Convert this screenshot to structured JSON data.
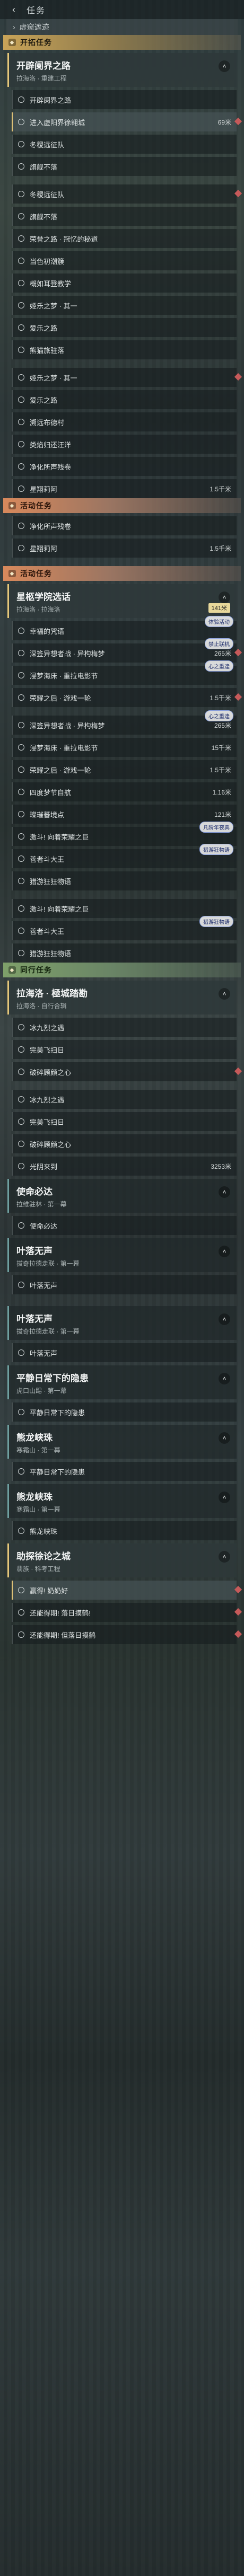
{
  "header": {
    "title": "任务",
    "hidden_toggle": "虚窥遮迹"
  },
  "categories": {
    "trailblaze": "开拓任务",
    "event": "活动任务",
    "companion": "同行任务"
  },
  "blocks": [
    {
      "type": "cat",
      "cls": "trailblaze",
      "key": "trailblaze"
    },
    {
      "type": "quest",
      "active": true,
      "title": "开辟阑界之路",
      "sub": "拉海洛 · 重建工程",
      "chev": "˄"
    },
    {
      "type": "step",
      "text": "开辟阑界之路"
    },
    {
      "type": "step",
      "hl": true,
      "text": "进入虚阳界徐翱城",
      "dist": "69米",
      "mark": true
    },
    {
      "type": "step",
      "text": "冬稷远征队"
    },
    {
      "type": "step",
      "text": "旗舰不落"
    },
    {
      "type": "gap"
    },
    {
      "type": "step",
      "text": "冬稷远征队",
      "mark": true
    },
    {
      "type": "step",
      "text": "旗舰不落"
    },
    {
      "type": "step",
      "text": "荣誉之路 · 冠忆的秘道"
    },
    {
      "type": "step",
      "text": "当色初潮簇"
    },
    {
      "type": "step",
      "text": "概如耳登教学"
    },
    {
      "type": "step",
      "text": "姬乐之梦 · 其一"
    },
    {
      "type": "step",
      "text": "爱乐之路"
    },
    {
      "type": "step",
      "text": "熊猫旅驻落"
    },
    {
      "type": "gap"
    },
    {
      "type": "step",
      "text": "姬乐之梦 · 其一",
      "mark": true
    },
    {
      "type": "step",
      "text": "爱乐之路"
    },
    {
      "type": "step",
      "text": "溯远布德村"
    },
    {
      "type": "step",
      "text": "类焰归还汪洋"
    },
    {
      "type": "step",
      "text": "净化所声残卷"
    },
    {
      "type": "step",
      "text": "星翔莉阿",
      "dist": "1.5千米"
    },
    {
      "type": "cat",
      "cls": "event",
      "key": "event"
    },
    {
      "type": "step",
      "text": "净化所声残卷"
    },
    {
      "type": "step",
      "text": "星翔莉阿",
      "dist": "1.5千米"
    },
    {
      "type": "section-gap"
    },
    {
      "type": "cat",
      "cls": "event",
      "key": "event"
    },
    {
      "type": "quest",
      "active": true,
      "title": "星柩学院选话",
      "sub": "拉海洛 · 拉海洛",
      "chev": "˄",
      "pill": "141米"
    },
    {
      "type": "step",
      "text": "幸福的咒语",
      "tag": "体验活动"
    },
    {
      "type": "step",
      "text": "深签异想者战 · 异构梅梦",
      "dist": "265米",
      "tag": "禁止联机",
      "mark": true
    },
    {
      "type": "step",
      "text": "浸梦海床 · 重拉电影节",
      "tag": "心之重逢"
    },
    {
      "type": "step",
      "text": "荣耀之后 · 游戏一轮",
      "dist": "1.5千米",
      "mark": true
    },
    {
      "type": "gap"
    },
    {
      "type": "step",
      "text": "深签异想者战 · 异构梅梦",
      "dist": "265米",
      "tag": "心之重逢"
    },
    {
      "type": "step",
      "text": "浸梦海床 · 重拉电影节",
      "dist": "15千米"
    },
    {
      "type": "step",
      "text": "荣耀之后 · 游戏一轮",
      "dist": "1.5千米"
    },
    {
      "type": "step",
      "text": "四度梦节自航",
      "dist": "1.16米"
    },
    {
      "type": "step",
      "text": "璨璀蕃境点",
      "dist": "121米"
    },
    {
      "type": "step",
      "text": "激斗! 向着荣耀之巨",
      "tag": "凡阶年夜典"
    },
    {
      "type": "step",
      "text": "善者斗大王",
      "tag": "猎游狂物语"
    },
    {
      "type": "step",
      "text": "猎游狂狂物语"
    },
    {
      "type": "gap"
    },
    {
      "type": "step",
      "text": "激斗! 向着荣耀之巨"
    },
    {
      "type": "step",
      "text": "善者斗大王",
      "tag": "猎游狂物语"
    },
    {
      "type": "step",
      "text": "猎游狂狂物语"
    },
    {
      "type": "cat",
      "cls": "companion",
      "key": "companion"
    },
    {
      "type": "quest",
      "active": true,
      "title": "拉海洛 · 極城踏勘",
      "sub": "拉海洛 · 自行合辑",
      "chev": "˄"
    },
    {
      "type": "step",
      "text": "冰九烈之遇"
    },
    {
      "type": "step",
      "text": "完美飞扫日"
    },
    {
      "type": "step",
      "text": "破碎顾颜之心",
      "mark": true
    },
    {
      "type": "gap"
    },
    {
      "type": "step",
      "text": "冰九烈之遇"
    },
    {
      "type": "step",
      "text": "完美飞扫日"
    },
    {
      "type": "step",
      "text": "破碎顾颜之心"
    },
    {
      "type": "step",
      "text": "光阴来到",
      "dist": "3253米"
    },
    {
      "type": "quest",
      "title": "使命必达",
      "sub": "拉维驻林 · 第一幕",
      "chev": "˄"
    },
    {
      "type": "step",
      "text": "使命必达"
    },
    {
      "type": "quest",
      "title": "叶落无声",
      "sub": "拔奇拉德走联 · 第一幕",
      "chev": "˄"
    },
    {
      "type": "step",
      "text": "叶落无声"
    },
    {
      "type": "section-gap"
    },
    {
      "type": "quest",
      "title": "叶落无声",
      "sub": "拔奇拉德走联 · 第一幕",
      "chev": "˄"
    },
    {
      "type": "step",
      "text": "叶落无声"
    },
    {
      "type": "quest",
      "title": "平静日常下的隐患",
      "sub": "虎口山踢 · 第一幕",
      "chev": "˄"
    },
    {
      "type": "step",
      "text": "平静日常下的隐患"
    },
    {
      "type": "quest",
      "title": "熊龙峡珠",
      "sub": "寒霜山 · 第一幕",
      "chev": "˄"
    },
    {
      "type": "step",
      "text": "平静日常下的隐患"
    },
    {
      "type": "quest",
      "title": "熊龙峡珠",
      "sub": "寒霜山 · 第一幕",
      "chev": "˄"
    },
    {
      "type": "step",
      "text": "熊龙峡珠"
    },
    {
      "type": "quest",
      "active": true,
      "title": "助探徐论之城",
      "sub": "翡族 · 科考工程",
      "chev": "˄"
    },
    {
      "type": "step",
      "hl": true,
      "text": "赢得! 奶奶好",
      "mark": true
    },
    {
      "type": "step",
      "text": "还能得期! 落日摸鹤!",
      "mark": true
    },
    {
      "type": "step",
      "text": "还能得期! 但落日摸鹤",
      "mark": true
    }
  ]
}
